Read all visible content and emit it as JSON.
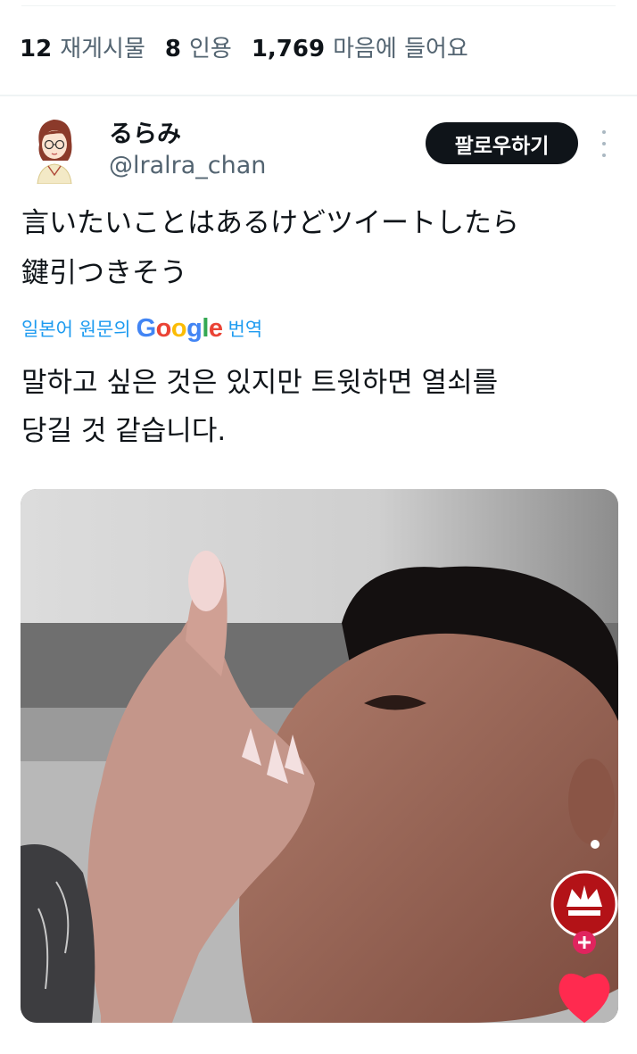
{
  "engagement": {
    "reposts_count": "12",
    "reposts_label": "재게시물",
    "quotes_count": "8",
    "quotes_label": "인용",
    "likes_count": "1,769",
    "likes_label": "마음에 들어요"
  },
  "author": {
    "display_name": "るらみ",
    "handle": "@lralra_chan",
    "avatar_icon": "anime-girl-avatar-icon"
  },
  "actions": {
    "follow_label": "팔로우하기",
    "more_icon": "more-vertical-icon"
  },
  "tweet": {
    "lines": [
      "言いたいことはあるけどツイートしたら",
      "鍵引つきそう"
    ]
  },
  "translation": {
    "prefix": "일본어 원문의",
    "google": [
      "G",
      "o",
      "o",
      "g",
      "l",
      "e"
    ],
    "suffix": "번역",
    "lines": [
      "말하고 싶은 것은 있지만 트윗하면 열쇠를",
      "당길 것 같습니다."
    ]
  },
  "media": {
    "overlay_logo_icon": "whatsup-crown-logo-icon",
    "overlay_plus_icon": "plus-icon",
    "overlay_heart_icon": "heart-icon"
  },
  "colors": {
    "text_primary": "#0f1419",
    "text_secondary": "#536471",
    "link": "#1d9bf0",
    "follow_bg": "#0f1419"
  }
}
